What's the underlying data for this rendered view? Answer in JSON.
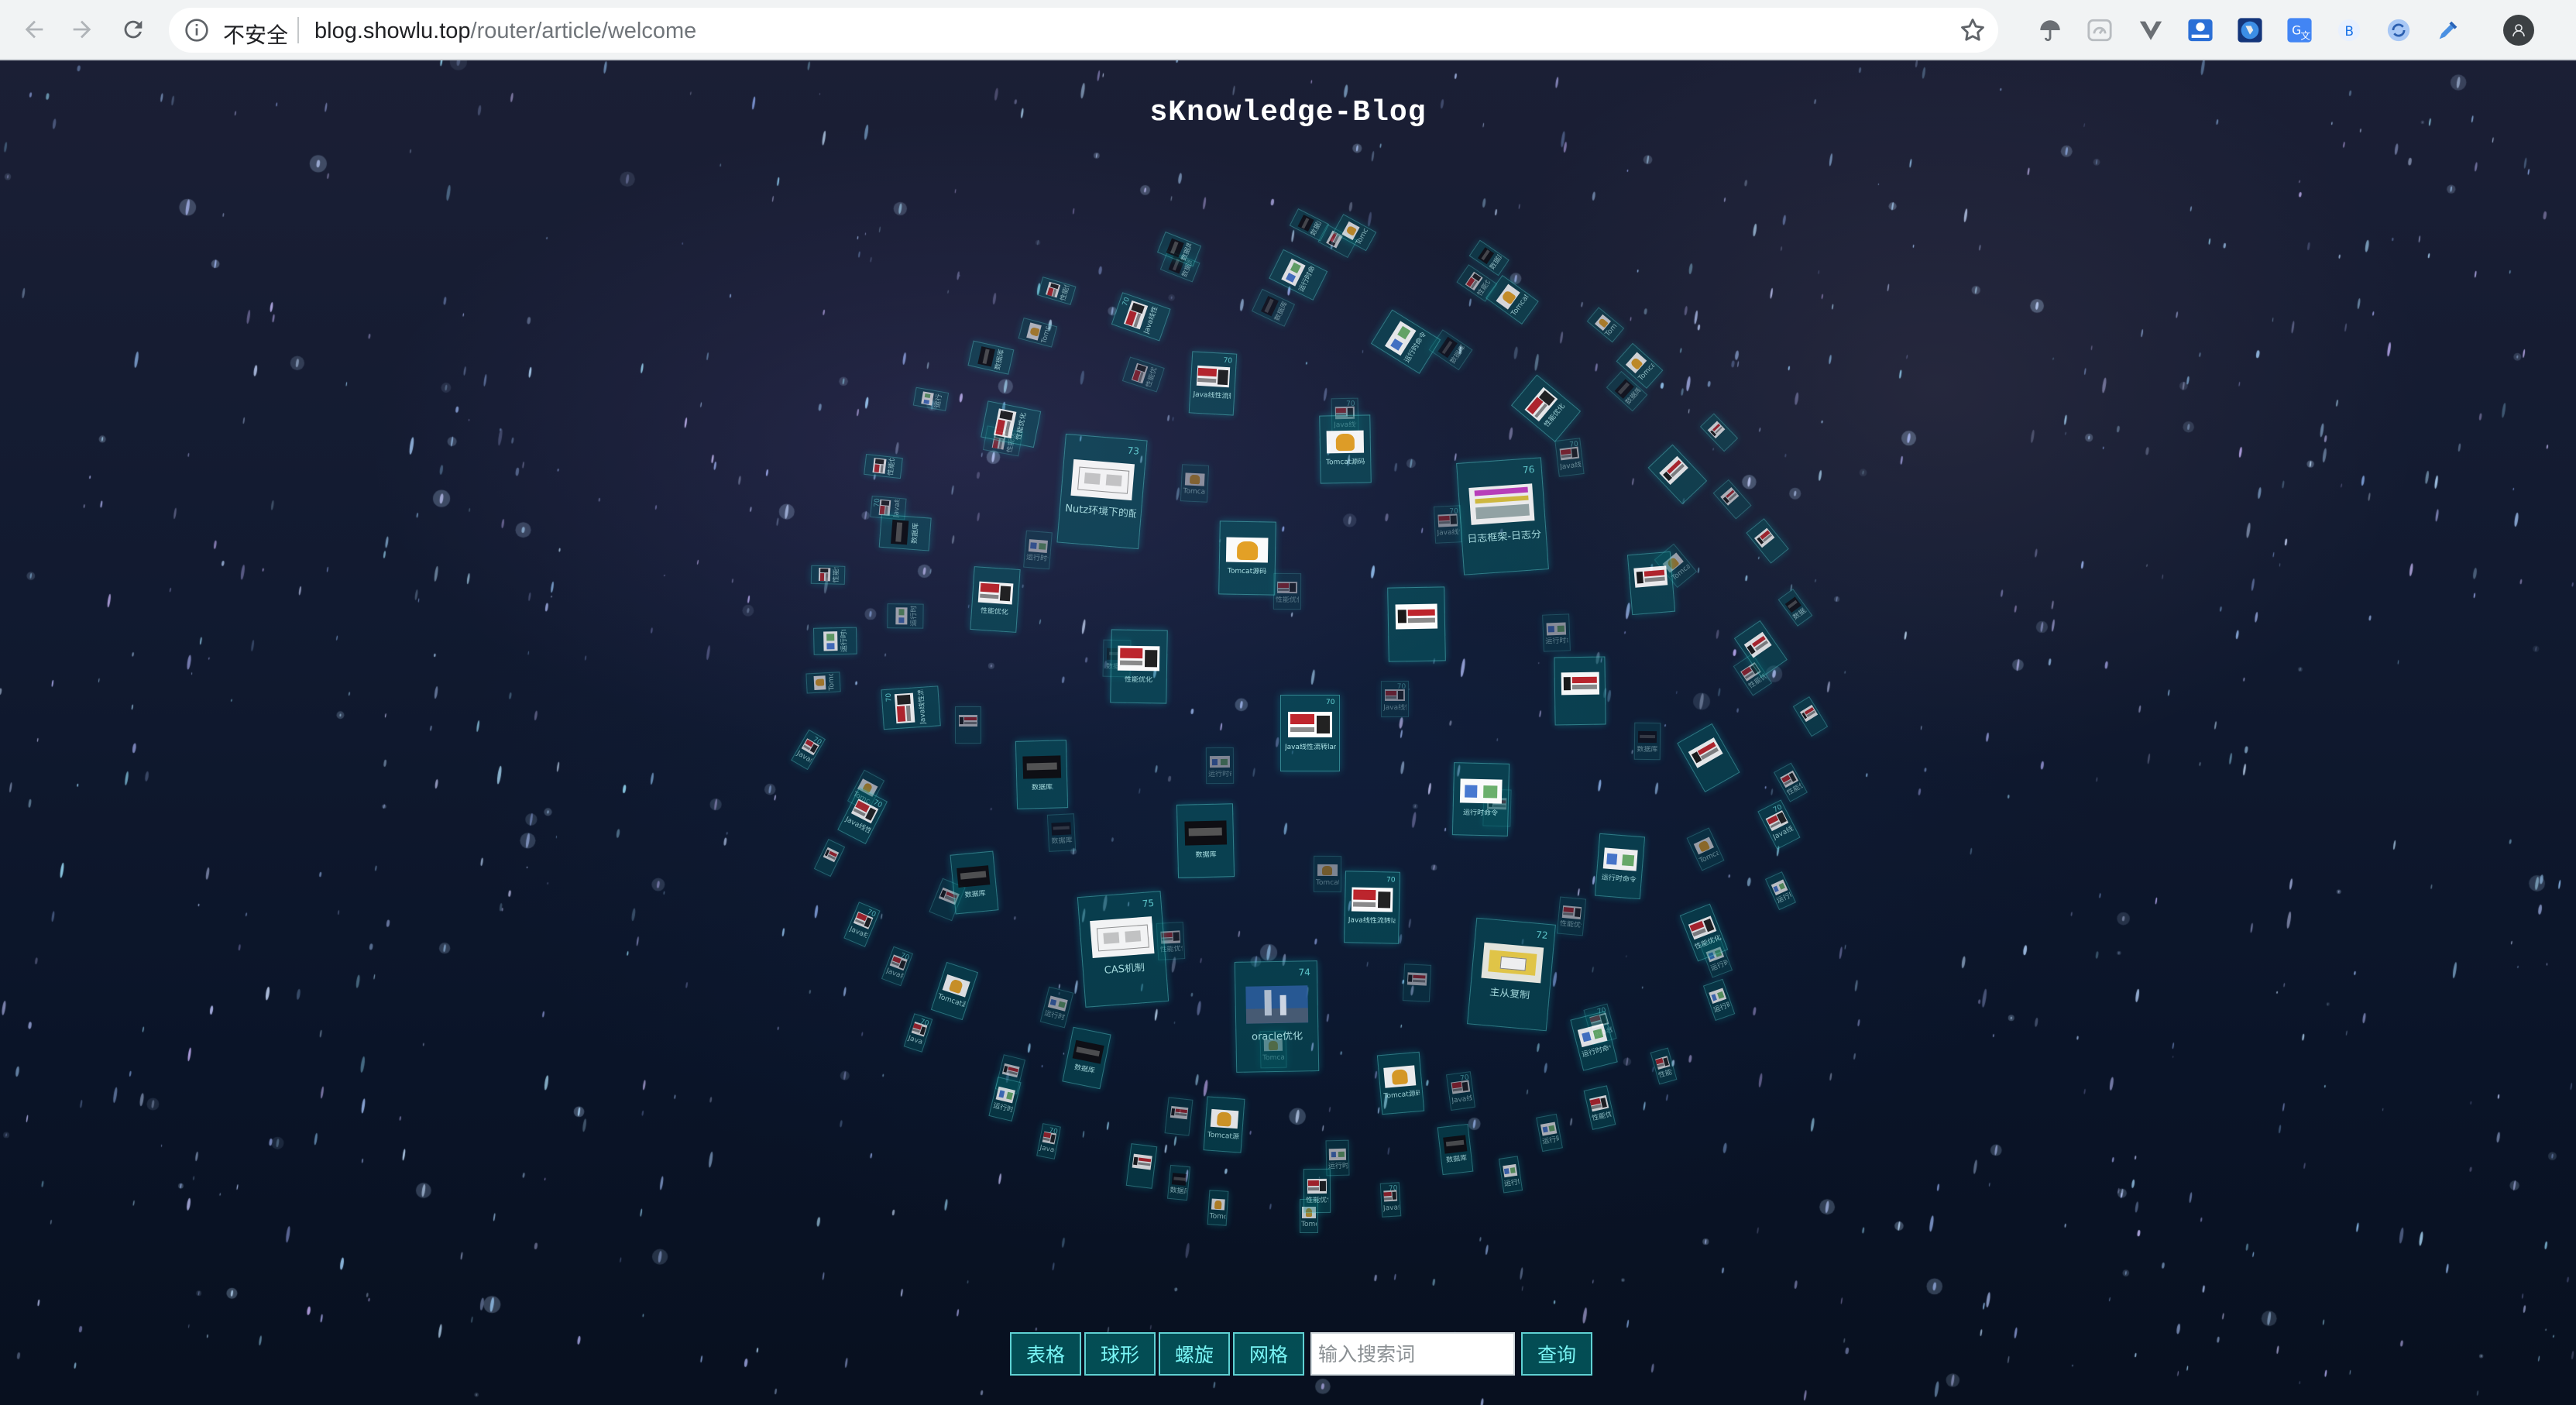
{
  "browser": {
    "security_label": "不安全",
    "url_host": "blog.showlu.top",
    "url_path": "/router/article/welcome",
    "extensions": [
      "umbrella-icon",
      "speedometer-icon",
      "vue-devtools-icon",
      "space-icon",
      "globe-icon",
      "translate-icon",
      "b-icon",
      "sync-icon",
      "eyedropper-icon",
      "profile-icon"
    ]
  },
  "page": {
    "title": "sKnowledge-Blog",
    "theme_color": "#007f7f"
  },
  "sphere_cards": [
    {
      "num": "72",
      "caption": "主从复制",
      "thumb": "diagram",
      "featured": true
    },
    {
      "num": "73",
      "caption": "Nutz环境下的配置",
      "thumb": "dbl",
      "featured": true
    },
    {
      "num": "74",
      "caption": "oracle优化",
      "thumb": "photo",
      "featured": true
    },
    {
      "num": "75",
      "caption": "CAS机制",
      "thumb": "dbl",
      "featured": true
    },
    {
      "num": "76",
      "caption": "日志框架-日志分片",
      "thumb": "doc",
      "featured": true
    },
    {
      "num": "70",
      "caption": "Java线性流转lambda表达式 Stream",
      "thumb": "oracle",
      "featured": false
    },
    {
      "num": "",
      "caption": "运行时命令",
      "thumb": "arch",
      "featured": false
    },
    {
      "num": "",
      "caption": "性能优化",
      "thumb": "oracle",
      "featured": false
    },
    {
      "num": "",
      "caption": "Tomcat源码",
      "thumb": "fox",
      "featured": false
    },
    {
      "num": "",
      "caption": "数据库",
      "thumb": "dark",
      "featured": false
    },
    {
      "num": "",
      "caption": "",
      "thumb": "logo",
      "featured": false
    }
  ],
  "menu": {
    "table_label": "表格",
    "sphere_label": "球形",
    "helix_label": "螺旋",
    "grid_label": "网格",
    "search_placeholder": "输入搜索词",
    "search_value": "",
    "query_label": "查询"
  }
}
